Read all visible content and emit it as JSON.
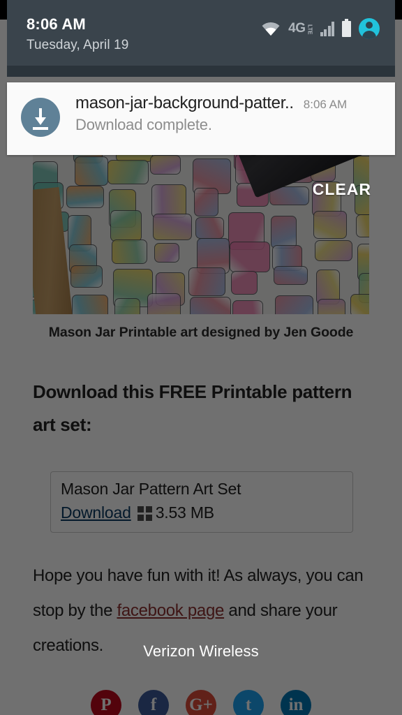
{
  "statusbar": {
    "time": "8:06 AM",
    "date": "Tuesday, April 19",
    "icons": {
      "wifi": "wifi-icon",
      "network_label": "4G",
      "network_sub": "LTE",
      "signal": "signal-bars-icon",
      "battery": "battery-icon",
      "avatar": "user-avatar-icon"
    },
    "bg_color": "#3a444c"
  },
  "notification": {
    "icon": "download-icon",
    "title": "mason-jar-background-patter..",
    "time": "8:06 AM",
    "subtitle": "Download complete.",
    "icon_color": "#5f8197",
    "card_color": "#fafafa"
  },
  "shade": {
    "clear_label": "CLEAR"
  },
  "toast": {
    "message": "Verizon Wireless"
  },
  "page": {
    "hero_alt": "mason-jar-watercolor-pattern-image",
    "caption": "Mason Jar Printable art designed by Jen Goode",
    "lede": "Download this FREE Printable pattern art set:",
    "download_box": {
      "title": "Mason Jar Pattern Art Set",
      "link_label": "Download",
      "grid_icon": "broken-image-icon",
      "size": "3.53 MB",
      "link_color": "#0b3a63"
    },
    "paragraph": {
      "before": "Hope you have fun with it! As always, you can stop by the ",
      "link": "facebook page",
      "after": " and share your creations.",
      "link_color": "#8d3030"
    },
    "social": [
      {
        "name": "pinterest",
        "glyph": "P",
        "color": "#bd081c"
      },
      {
        "name": "facebook",
        "glyph": "f",
        "color": "#3b5998"
      },
      {
        "name": "google-plus",
        "glyph": "G+",
        "color": "#dd4b39"
      },
      {
        "name": "twitter",
        "glyph": "t",
        "color": "#1da1f2"
      },
      {
        "name": "linkedin",
        "glyph": "in",
        "color": "#0077b5"
      }
    ]
  }
}
